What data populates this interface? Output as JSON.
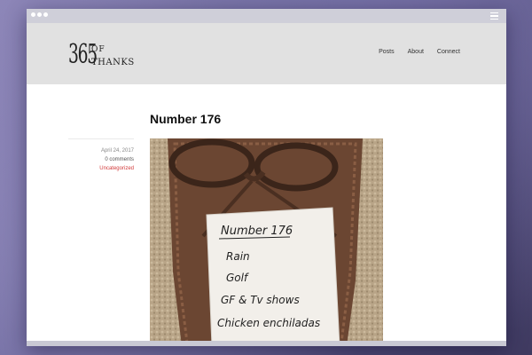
{
  "site": {
    "logo_number": "365",
    "logo_of": "OF",
    "logo_thanks": "THANKS"
  },
  "nav": {
    "items": [
      {
        "label": "Posts"
      },
      {
        "label": "About"
      },
      {
        "label": "Connect"
      }
    ]
  },
  "post": {
    "title": "Number 176",
    "date": "April 24, 2017",
    "comments": "0 comments",
    "category": "Uncategorized",
    "note_lines": [
      "Number 176",
      "Rain",
      "Golf",
      "GF & Tv shows",
      "Chicken enchiladas"
    ]
  },
  "colors": {
    "header_bg": "#e1e1e1",
    "category_link": "#d23a3a",
    "backdrop": "#6e6a9e"
  }
}
